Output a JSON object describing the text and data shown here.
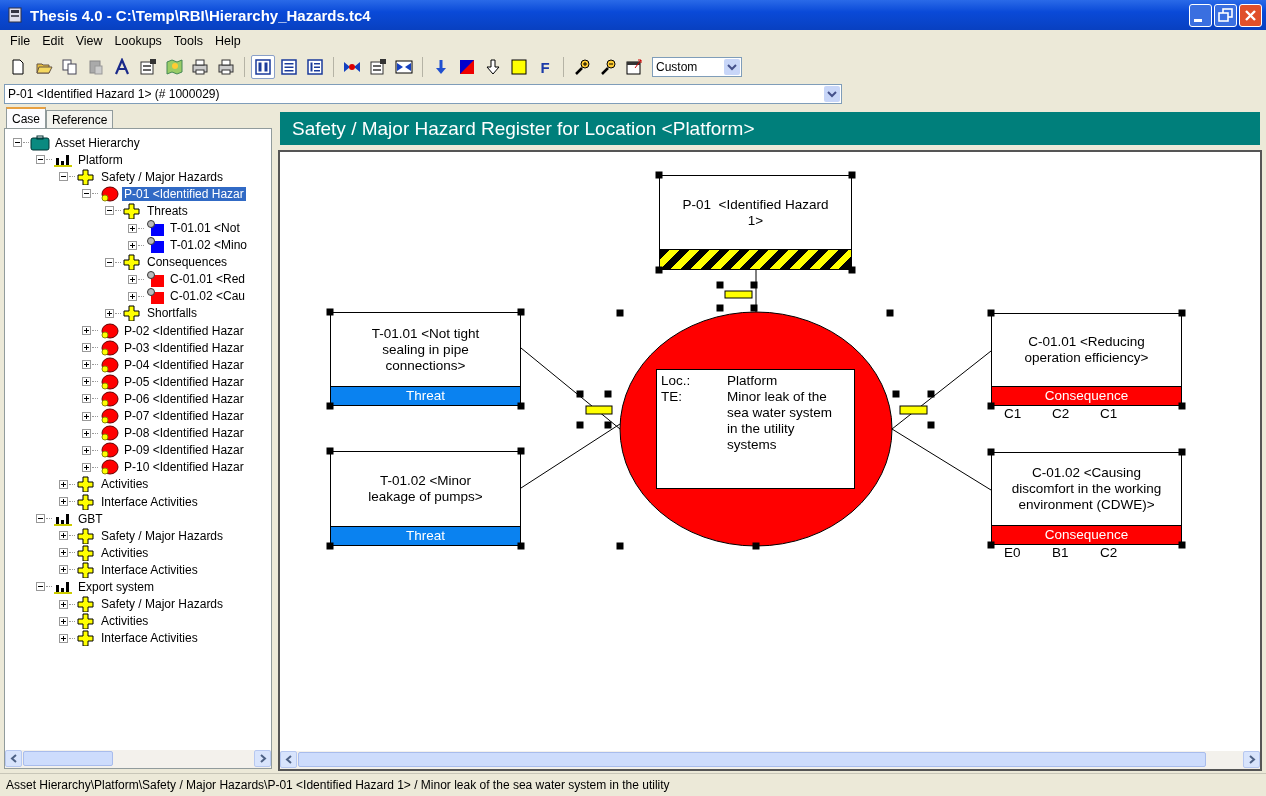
{
  "window": {
    "title": "Thesis 4.0 - C:\\Temp\\RBI\\Hierarchy_Hazards.tc4"
  },
  "menu": [
    "File",
    "Edit",
    "View",
    "Lookups",
    "Tools",
    "Help"
  ],
  "toolbar": {
    "view_buttons": [
      {
        "selected": true
      },
      {
        "selected": false
      },
      {
        "selected": false
      }
    ],
    "format_button": "F",
    "zoom_combo": "Custom"
  },
  "address_combo": {
    "value": "P-01 <Identified Hazard 1> (# 1000029)"
  },
  "tabs": [
    {
      "label": "Case",
      "selected": true
    },
    {
      "label": "Reference",
      "selected": false
    }
  ],
  "tree": [
    {
      "label": "Asset Hierarchy",
      "kind": "root",
      "expanded": true,
      "selected": false,
      "children": [
        {
          "label": "Platform",
          "kind": "location",
          "expanded": true,
          "selected": false,
          "children": [
            {
              "label": "Safety / Major Hazards",
              "kind": "folder",
              "expanded": true,
              "selected": false,
              "children": [
                {
                  "label": "P-01 <Identified Hazar",
                  "kind": "hazard",
                  "expanded": true,
                  "selected": true,
                  "children": [
                    {
                      "label": "Threats",
                      "kind": "folder",
                      "expanded": true,
                      "selected": false,
                      "children": [
                        {
                          "label": "T-01.01 <Not",
                          "kind": "threat",
                          "expanded": false,
                          "selected": false
                        },
                        {
                          "label": "T-01.02 <Mino",
                          "kind": "threat",
                          "expanded": false,
                          "selected": false
                        }
                      ]
                    },
                    {
                      "label": "Consequences",
                      "kind": "folder",
                      "expanded": true,
                      "selected": false,
                      "children": [
                        {
                          "label": "C-01.01 <Red",
                          "kind": "consequence",
                          "expanded": false,
                          "selected": false
                        },
                        {
                          "label": "C-01.02 <Cau",
                          "kind": "consequence",
                          "expanded": false,
                          "selected": false
                        }
                      ]
                    },
                    {
                      "label": "Shortfalls",
                      "kind": "folder",
                      "expanded": false,
                      "selected": false
                    }
                  ]
                },
                {
                  "label": "P-02 <Identified Hazar",
                  "kind": "hazard",
                  "expanded": false,
                  "selected": false
                },
                {
                  "label": "P-03 <Identified Hazar",
                  "kind": "hazard",
                  "expanded": false,
                  "selected": false
                },
                {
                  "label": "P-04 <Identified Hazar",
                  "kind": "hazard",
                  "expanded": false,
                  "selected": false
                },
                {
                  "label": "P-05 <Identified Hazar",
                  "kind": "hazard",
                  "expanded": false,
                  "selected": false
                },
                {
                  "label": "P-06 <Identified Hazar",
                  "kind": "hazard",
                  "expanded": false,
                  "selected": false
                },
                {
                  "label": "P-07 <Identified Hazar",
                  "kind": "hazard",
                  "expanded": false,
                  "selected": false
                },
                {
                  "label": "P-08 <Identified Hazar",
                  "kind": "hazard",
                  "expanded": false,
                  "selected": false
                },
                {
                  "label": "P-09 <Identified Hazar",
                  "kind": "hazard",
                  "expanded": false,
                  "selected": false
                },
                {
                  "label": "P-10 <Identified Hazar",
                  "kind": "hazard",
                  "expanded": false,
                  "selected": false
                }
              ]
            },
            {
              "label": "Activities",
              "kind": "folder",
              "expanded": false,
              "selected": false
            },
            {
              "label": "Interface Activities",
              "kind": "folder",
              "expanded": false,
              "selected": false
            }
          ]
        },
        {
          "label": "GBT",
          "kind": "location",
          "expanded": true,
          "selected": false,
          "children": [
            {
              "label": "Safety / Major Hazards",
              "kind": "folder",
              "expanded": false,
              "selected": false
            },
            {
              "label": "Activities",
              "kind": "folder",
              "expanded": false,
              "selected": false
            },
            {
              "label": "Interface Activities",
              "kind": "folder",
              "expanded": false,
              "selected": false
            }
          ]
        },
        {
          "label": "Export system",
          "kind": "location",
          "expanded": true,
          "selected": false,
          "children": [
            {
              "label": "Safety / Major Hazards",
              "kind": "folder",
              "expanded": false,
              "selected": false
            },
            {
              "label": "Activities",
              "kind": "folder",
              "expanded": false,
              "selected": false
            },
            {
              "label": "Interface Activities",
              "kind": "folder",
              "expanded": false,
              "selected": false
            }
          ]
        }
      ]
    }
  ],
  "diagram": {
    "title": "Safety / Major Hazard Register for Location <Platform>",
    "hazard": {
      "label": "P-01  <Identified Hazard 1>"
    },
    "center": {
      "rows": [
        {
          "label": "Loc.:",
          "value": "Platform"
        },
        {
          "label": "TE:",
          "value": "Minor leak of the sea water system in the utility systems"
        }
      ]
    },
    "threats": [
      {
        "label": "T-01.01 <Not tight sealing in pipe connections>",
        "band": "Threat"
      },
      {
        "label": "T-01.02 <Minor leakage of pumps>",
        "band": "Threat"
      }
    ],
    "consequences": [
      {
        "label": "C-01.01 <Reducing operation efficiency>",
        "band": "Consequence",
        "ratings": [
          "C1",
          "C2",
          "C1"
        ]
      },
      {
        "label": "C-01.02 <Causing discomfort in the working environment (CDWE)>",
        "band": "Consequence",
        "ratings": [
          "E0",
          "B1",
          "C2"
        ]
      }
    ]
  },
  "status_bar": "Asset Hierarchy\\Platform\\Safety / Major Hazards\\P-01 <Identified Hazard 1> / Minor leak of the sea water system in the utility"
}
